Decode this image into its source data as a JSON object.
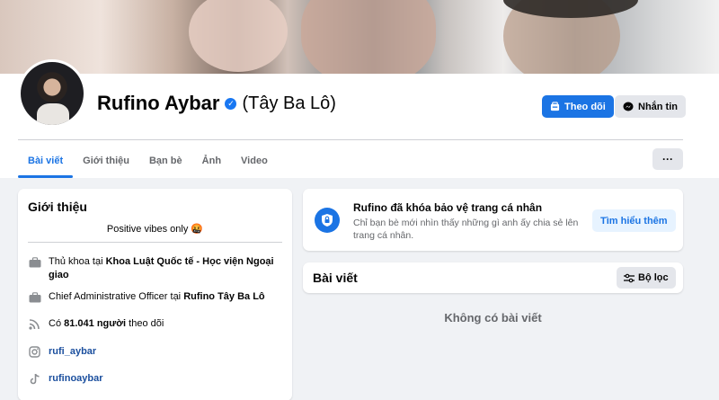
{
  "profile": {
    "name": "Rufino Aybar",
    "alias": "(Tây Ba Lô)",
    "verified": true,
    "follow_label": "Theo dõi",
    "message_label": "Nhắn tin"
  },
  "tabs": [
    {
      "label": "Bài viết",
      "active": true
    },
    {
      "label": "Giới thiệu",
      "active": false
    },
    {
      "label": "Bạn bè",
      "active": false
    },
    {
      "label": "Ảnh",
      "active": false
    },
    {
      "label": "Video",
      "active": false
    }
  ],
  "more_label": "···",
  "intro": {
    "title": "Giới thiệu",
    "bio": "Positive vibes only 🤬",
    "education_prefix": "Thủ khoa tại ",
    "education_place": "Khoa Luật Quốc tế - Học viện Ngoại giao",
    "work_prefix": "Chief Administrative Officer tại ",
    "work_place": "Rufino Tây Ba Lô",
    "followers_prefix": "Có ",
    "followers_count": "81.041 người",
    "followers_suffix": " theo dõi",
    "instagram": "rufi_aybar",
    "tiktok": "rufinoaybar"
  },
  "locked": {
    "title": "Rufino đã khóa bảo vệ trang cá nhân",
    "description": "Chỉ bạn bè mới nhìn thấy những gì anh ấy chia sẻ lên trang cá nhân.",
    "learn_more": "Tìm hiểu thêm"
  },
  "posts": {
    "title": "Bài viết",
    "filter_label": "Bộ lọc",
    "empty_text": "Không có bài viết"
  },
  "colors": {
    "accent": "#1b74e4",
    "background": "#f0f2f5",
    "secondary_text": "#65676b"
  }
}
